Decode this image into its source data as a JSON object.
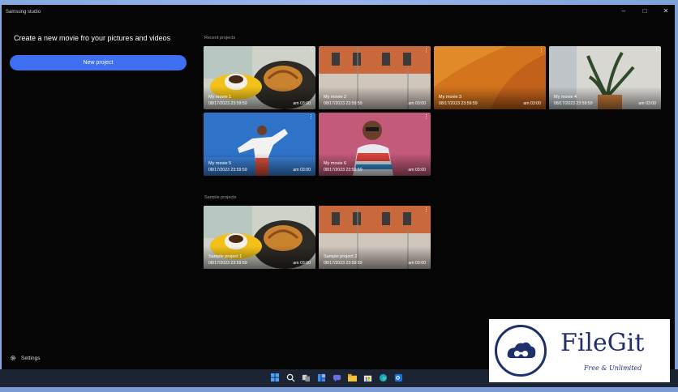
{
  "window": {
    "title": "Samsung studio",
    "controls": {
      "minimize": "–",
      "maximize": "□",
      "close": "✕"
    }
  },
  "left_pane": {
    "headline": "Create a new movie fro your pictures and videos",
    "new_project_label": "New project",
    "settings_label": "Settings"
  },
  "recent": {
    "label": "Recent projects",
    "cards": [
      {
        "name": "My movie 1",
        "date": "08/17/2023 23:59:59",
        "time": "am 03:00",
        "thumb": "coffee"
      },
      {
        "name": "My movie 2",
        "date": "08/17/2023 23:59:59",
        "time": "am 03:00",
        "thumb": "building"
      },
      {
        "name": "My movie 3",
        "date": "08/17/2023 23:59:59",
        "time": "am 03:00",
        "thumb": "orange"
      },
      {
        "name": "My movie 4",
        "date": "08/17/2023 23:59:59",
        "time": "am 03:00",
        "thumb": "plant"
      },
      {
        "name": "My movie 5",
        "date": "08/17/2023 23:59:59",
        "time": "am 03:00",
        "thumb": "dancer"
      },
      {
        "name": "My movie 6",
        "date": "08/17/2023 23:59:59",
        "time": "am 03:00",
        "thumb": "portrait"
      }
    ]
  },
  "samples": {
    "label": "Sample projects",
    "cards": [
      {
        "name": "Sample project 1",
        "date": "08/17/2023 23:59:59",
        "time": "am 03:00",
        "thumb": "coffee"
      },
      {
        "name": "Sample project 2",
        "date": "08/17/2023 23:59:59",
        "time": "am 03:00",
        "thumb": "building"
      }
    ]
  },
  "more_glyph": "⋮",
  "taskbar_icons": [
    "windows-start-icon",
    "search-icon",
    "task-view-icon",
    "widgets-icon",
    "teams-chat-icon",
    "file-explorer-icon",
    "store-icon",
    "edge-icon",
    "outlook-icon"
  ],
  "watermark": {
    "brand": "FileGit",
    "tagline": "Free & Unlimited"
  },
  "colors": {
    "accent": "#3d6ff0",
    "window_bg": "#050505",
    "taskbar_bg": "#1c2433",
    "watermark_text": "#1f2f6b"
  }
}
